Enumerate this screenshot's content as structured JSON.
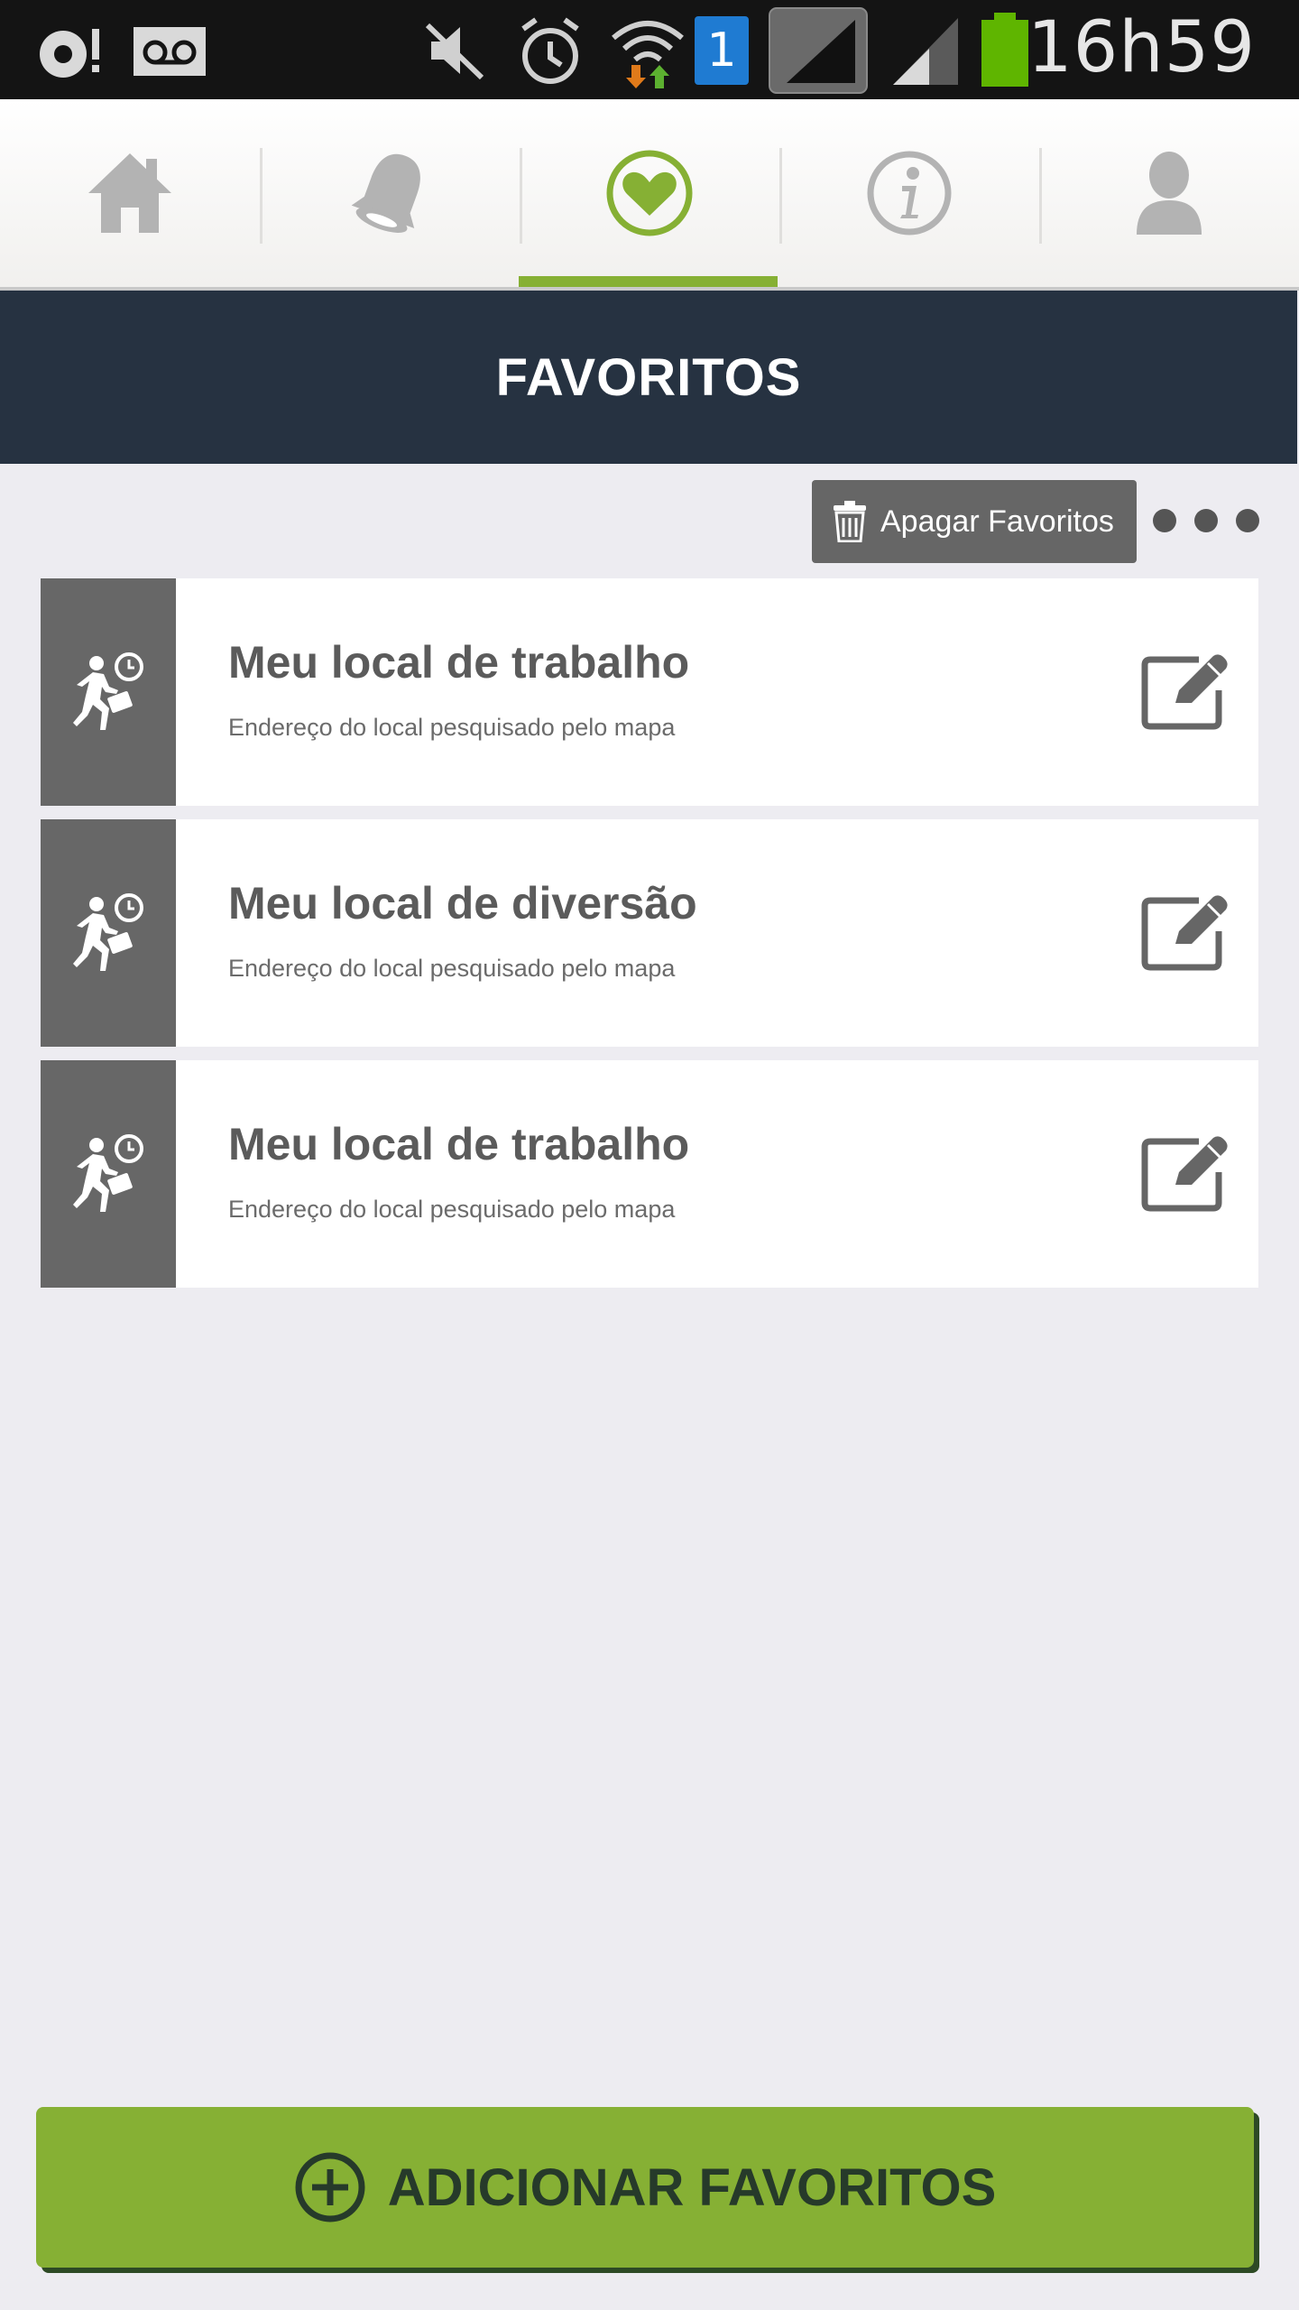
{
  "status_bar": {
    "time": "16h59",
    "sim_slot": "1",
    "icons": [
      "bluetooth-tethering-icon",
      "voicemail-icon",
      "mute-icon",
      "alarm-icon",
      "wifi-icon",
      "sim-icon",
      "signal-icon",
      "signal-icon-2",
      "battery-icon"
    ],
    "battery_color": "#5fb500"
  },
  "nav": {
    "items": [
      {
        "name": "home",
        "icon": "home-icon"
      },
      {
        "name": "notifications",
        "icon": "bell-icon"
      },
      {
        "name": "favorites",
        "icon": "heart-icon",
        "active": true
      },
      {
        "name": "info",
        "icon": "info-icon"
      },
      {
        "name": "profile",
        "icon": "user-icon"
      }
    ],
    "accent_color": "#86b034",
    "inactive_color": "#b3b3b3"
  },
  "header": {
    "title": "FAVORITOS"
  },
  "toolbar": {
    "delete_label": "Apagar Favoritos",
    "delete_icon": "trash-icon",
    "more_icon": "more-dots-icon"
  },
  "favorites": [
    {
      "title": "Meu local de trabalho",
      "subtitle": "Endereço do local pesquisado pelo mapa",
      "icon": "commuter-icon"
    },
    {
      "title": "Meu local de diversão",
      "subtitle": "Endereço do local pesquisado pelo mapa",
      "icon": "commuter-icon"
    },
    {
      "title": "Meu local de trabalho",
      "subtitle": "Endereço do local pesquisado pelo mapa",
      "icon": "commuter-icon"
    }
  ],
  "footer": {
    "add_label": "ADICIONAR FAVORITOS",
    "add_icon": "plus-circle-icon",
    "button_color": "#86b034"
  }
}
